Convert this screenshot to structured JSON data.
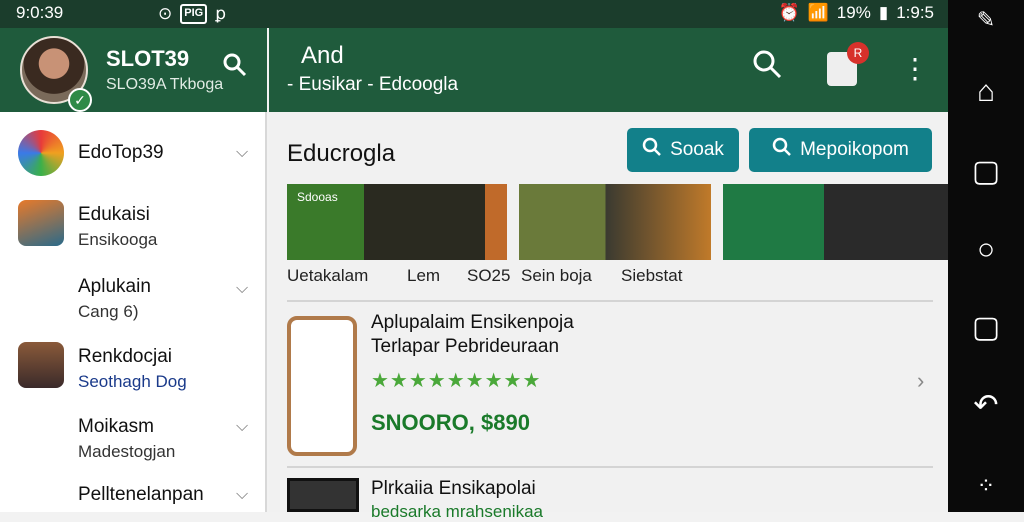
{
  "status_bar": {
    "time": "9:0:39",
    "left_icons": [
      "⊙",
      "Pᴵᴳ",
      "ꝑ"
    ],
    "right_text": "19%",
    "right_time": "1:9:5"
  },
  "sidebar_header": {
    "title": "SLOT39",
    "subtitle": "SLO39A Tkboga"
  },
  "sidebar": {
    "items": [
      {
        "label": "EdoTop39",
        "sub": ""
      },
      {
        "label": "Edukaisi",
        "sub": "Ensikooga"
      },
      {
        "label": "Aplukain",
        "sub": "Cang 6)"
      },
      {
        "label": "Renkdocjai",
        "sub": "Seothagh Dog"
      },
      {
        "label": "Moikasm",
        "sub": "Madestogjan"
      },
      {
        "label": "Pelltenelanpan",
        "sub": ""
      }
    ]
  },
  "main_header": {
    "title": "And",
    "subtitle": "- Eusikar - Edcoogla"
  },
  "notification_badge": "R",
  "section_title": "Educrogla",
  "buttons": {
    "search": "Sooak",
    "more": "Mepoikopom"
  },
  "banners": [
    {
      "label": "Sdooas"
    },
    {
      "label": ""
    },
    {
      "label": ""
    }
  ],
  "captions": [
    "Uetakalam",
    "Lem",
    "SO25",
    "Sein boja",
    "Siebstat"
  ],
  "cards": [
    {
      "title_line1": "Aplupalaim Ensikenpoja",
      "title_line2": "Terlapar Pebrideuraan",
      "stars": "★★★★★★★★★",
      "price": "SNOORO, $890"
    },
    {
      "title_line1": "Plrkaiia Ensikapolai",
      "sub": "bedsarka mrahsenikaa"
    }
  ],
  "colors": {
    "header_green": "#1f5b3c",
    "status_green": "#1b3d2c",
    "teal_button": "#12808a",
    "badge_red": "#d7312b"
  },
  "icons": {
    "search": "search-icon",
    "notification": "notification-icon",
    "more": "more-vertical-icon",
    "verified": "check-badge-icon"
  }
}
